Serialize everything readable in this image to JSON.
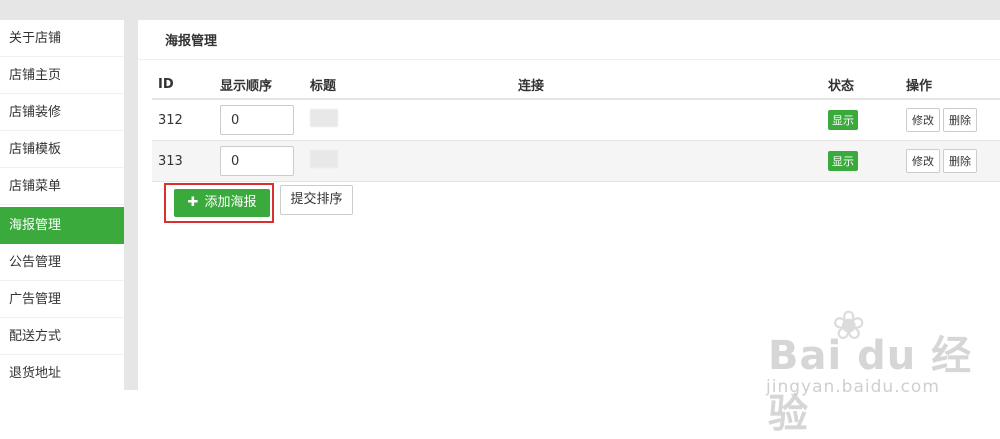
{
  "sidebar": {
    "items": [
      {
        "label": "关于店铺",
        "active": false
      },
      {
        "label": "店铺主页",
        "active": false
      },
      {
        "label": "店铺装修",
        "active": false
      },
      {
        "label": "店铺模板",
        "active": false
      },
      {
        "label": "店铺菜单",
        "active": false
      },
      {
        "label": "海报管理",
        "active": true
      },
      {
        "label": "公告管理",
        "active": false
      },
      {
        "label": "广告管理",
        "active": false
      },
      {
        "label": "配送方式",
        "active": false
      },
      {
        "label": "退货地址",
        "active": false
      }
    ]
  },
  "main": {
    "title": "海报管理",
    "table": {
      "headers": [
        "ID",
        "显示顺序",
        "标题",
        "连接",
        "状态",
        "操作"
      ],
      "rows": [
        {
          "id": "312",
          "order": "0",
          "status": "显示",
          "edit": "修改",
          "delete": "删除"
        },
        {
          "id": "313",
          "order": "0",
          "status": "显示",
          "edit": "修改",
          "delete": "删除"
        }
      ]
    },
    "add_button": "添加海报",
    "submit_button": "提交排序"
  },
  "watermark": {
    "logo": "Bai du 经验",
    "url": "jingyan.baidu.com"
  },
  "colors": {
    "accent": "#3aaa3c",
    "highlight": "#d9302f"
  }
}
